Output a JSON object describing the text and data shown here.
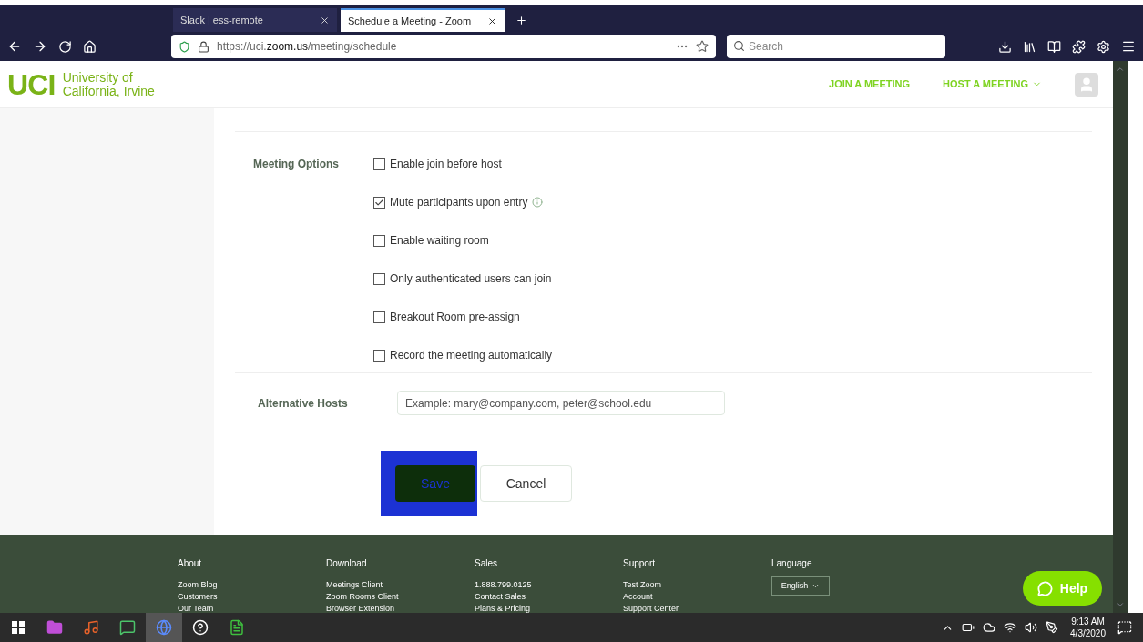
{
  "browser": {
    "tabs": [
      {
        "title": "Slack | ess-remote",
        "selected": false
      },
      {
        "title": "Schedule a Meeting - Zoom",
        "selected": true
      }
    ],
    "url": "https://uci.**zoom.us**/meeting/schedule",
    "search": {
      "placeholder": "Search"
    }
  },
  "site": {
    "logo": "UCI",
    "logo_text": [
      "University of",
      "California, Irvine"
    ],
    "nav": [
      "JOIN A MEETING",
      "HOST A MEETING"
    ]
  },
  "meeting_options": {
    "label": "Meeting Options",
    "options": [
      {
        "label": "Enable join before host",
        "checked": false,
        "info": false
      },
      {
        "label": "Mute participants upon entry",
        "checked": true,
        "info": true
      },
      {
        "label": "Enable waiting room",
        "checked": false,
        "info": false
      },
      {
        "label": "Only authenticated users can join",
        "checked": false,
        "info": false
      },
      {
        "label": "Breakout Room pre-assign",
        "checked": false,
        "info": false
      },
      {
        "label": "Record the meeting automatically",
        "checked": false,
        "info": false
      }
    ]
  },
  "alternative_hosts": {
    "label": "Alternative Hosts",
    "placeholder": "Example: mary@company.com, peter@school.edu"
  },
  "buttons": [
    {
      "label": "Save",
      "kind": "primary"
    },
    {
      "label": "Cancel",
      "kind": "secondary"
    }
  ],
  "footer": {
    "columns": [
      {
        "title": "About",
        "links": [
          "Zoom Blog",
          "Customers",
          "Our Team"
        ]
      },
      {
        "title": "Download",
        "links": [
          "Meetings Client",
          "Zoom Rooms Client",
          "Browser Extension"
        ]
      },
      {
        "title": "Sales",
        "links": [
          "1.888.799.0125",
          "Contact Sales",
          "Plans & Pricing"
        ]
      },
      {
        "title": "Support",
        "links": [
          "Test Zoom",
          "Account",
          "Support Center"
        ]
      }
    ],
    "language": {
      "title": "Language",
      "value": "English"
    },
    "help": "Help"
  },
  "taskbar": {
    "time": "9:13 AM",
    "date": "4/3/2020"
  }
}
